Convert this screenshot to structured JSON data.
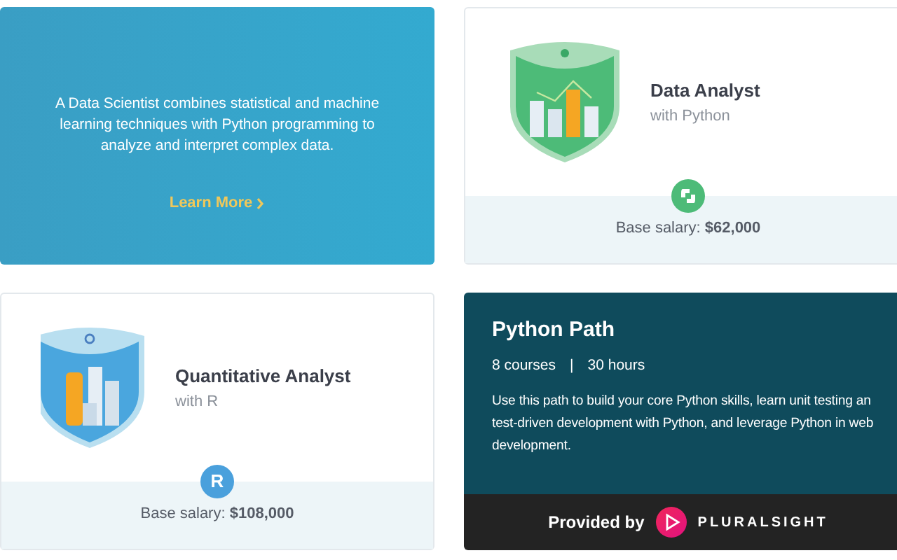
{
  "cards": [
    {
      "kind": "overlay",
      "description_lines": [
        "A Data Scientist combines statistical and machine",
        "learning techniques with Python programming to",
        "analyze and interpret complex data."
      ],
      "link": "Learn More"
    },
    {
      "kind": "career",
      "art": {
        "kind": "chart"
      },
      "title": "Data Analyst",
      "subtitle": "with Python",
      "badge": {
        "kind": "python"
      },
      "salary": "Base salary: **$62,000**"
    },
    {
      "kind": "career",
      "art": {
        "kind": "money"
      },
      "title": "Quantitative Analyst",
      "subtitle": "with R",
      "badge": {
        "kind": "r",
        "text": "R"
      },
      "salary": "Base salary: **$108,000**"
    },
    {
      "kind": "path",
      "title": "Python Path",
      "meta": [
        "8 courses",
        "30 hours"
      ],
      "meta_separator": "|",
      "description_lines": [
        "Use this path to build your core Python skills, learn unit testing an",
        "test-driven development with Python, and leverage Python in web",
        "development."
      ],
      "provided_by": "Provided by",
      "brand": "PLURALSIGHT"
    }
  ]
}
